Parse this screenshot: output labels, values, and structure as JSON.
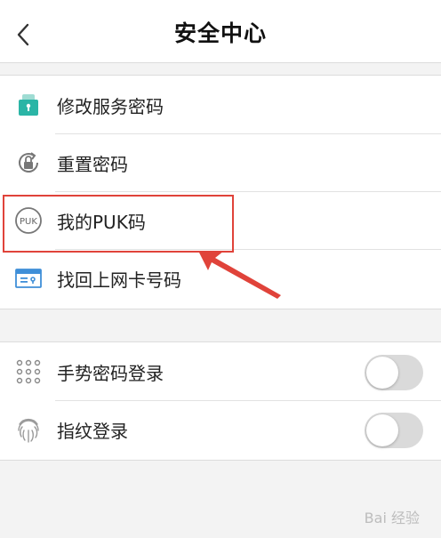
{
  "header": {
    "title": "安全中心",
    "back_icon": "chevron-left-icon"
  },
  "security_items": [
    {
      "label": "修改服务密码",
      "icon": "lock-card-icon"
    },
    {
      "label": "重置密码",
      "icon": "reset-lock-icon"
    },
    {
      "label": "我的PUK码",
      "icon": "puk-icon",
      "highlighted": true
    },
    {
      "label": "找回上网卡号码",
      "icon": "sim-card-icon"
    }
  ],
  "login_items": [
    {
      "label": "手势密码登录",
      "icon": "gesture-grid-icon",
      "enabled": false
    },
    {
      "label": "指纹登录",
      "icon": "fingerprint-icon",
      "enabled": false
    }
  ],
  "annotation": {
    "color": "#e0433a"
  },
  "colors": {
    "accent_icon": "#2bb5a6",
    "toggle_off": "#dadada"
  },
  "watermark": "Bai 经验"
}
